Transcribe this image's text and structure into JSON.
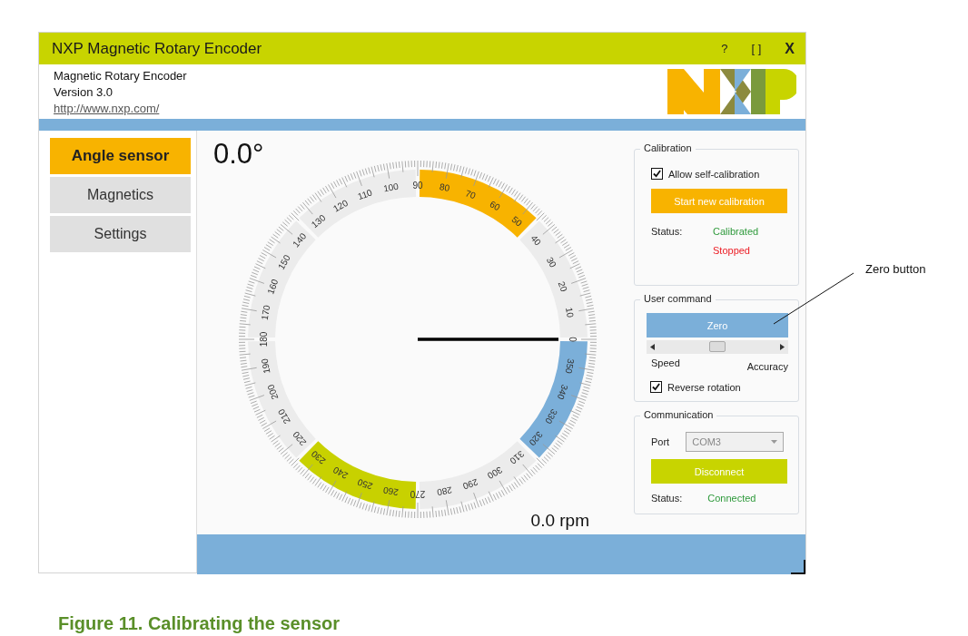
{
  "window": {
    "title": "NXP Magnetic Rotary Encoder",
    "controls": [
      "?",
      "[ ]",
      "X"
    ]
  },
  "header": {
    "app_name": "Magnetic Rotary Encoder",
    "version": "Version 3.0",
    "link": "http://www.nxp.com/"
  },
  "nav": [
    {
      "label": "Angle sensor",
      "selected": true
    },
    {
      "label": "Magnetics",
      "selected": false
    },
    {
      "label": "Settings",
      "selected": false
    }
  ],
  "dial": {
    "reading": "0.0°",
    "speed": "0.0 rpm",
    "labels": [
      "0",
      "10",
      "20",
      "30",
      "40",
      "50",
      "60",
      "70",
      "80",
      "90",
      "100",
      "110",
      "120",
      "130",
      "140",
      "150",
      "160",
      "170",
      "180",
      "190",
      "200",
      "210",
      "220",
      "230",
      "240",
      "250",
      "260",
      "270",
      "280",
      "290",
      "300",
      "310",
      "320",
      "330",
      "340",
      "350"
    ],
    "sectors": [
      {
        "color": "#ececec"
      },
      {
        "color": "#f8b300"
      },
      {
        "color": "#ececec"
      },
      {
        "color": "#ececec"
      },
      {
        "color": "#ececec"
      },
      {
        "color": "#c8d100"
      },
      {
        "color": "#ececec"
      },
      {
        "color": "#7bafd9"
      }
    ]
  },
  "calibration": {
    "title": "Calibration",
    "self_calibration": {
      "label": "Allow self-calibration",
      "checked": true
    },
    "button": "Start new calibration",
    "status_label": "Status:",
    "status": [
      {
        "text": "Calibrated",
        "color": "#2f9a3c"
      },
      {
        "text": "Stopped",
        "color": "#ec1c24"
      }
    ]
  },
  "user_command": {
    "title": "User command",
    "zero_button": "Zero",
    "slider": {
      "level": 0.5,
      "min_label": "Speed",
      "max_label": "Accuracy"
    },
    "reverse_rotation": {
      "label": "Reverse rotation",
      "checked": true
    }
  },
  "communication": {
    "title": "Communication",
    "port_label": "Port",
    "port": {
      "value": "COM3",
      "disabled": true
    },
    "button": "Disconnect",
    "status_label": "Status:",
    "status": {
      "text": "Connected",
      "color": "#2f9a3c"
    }
  },
  "annotation": {
    "text": "Zero button"
  },
  "caption": "Figure 11. Calibrating the sensor"
}
